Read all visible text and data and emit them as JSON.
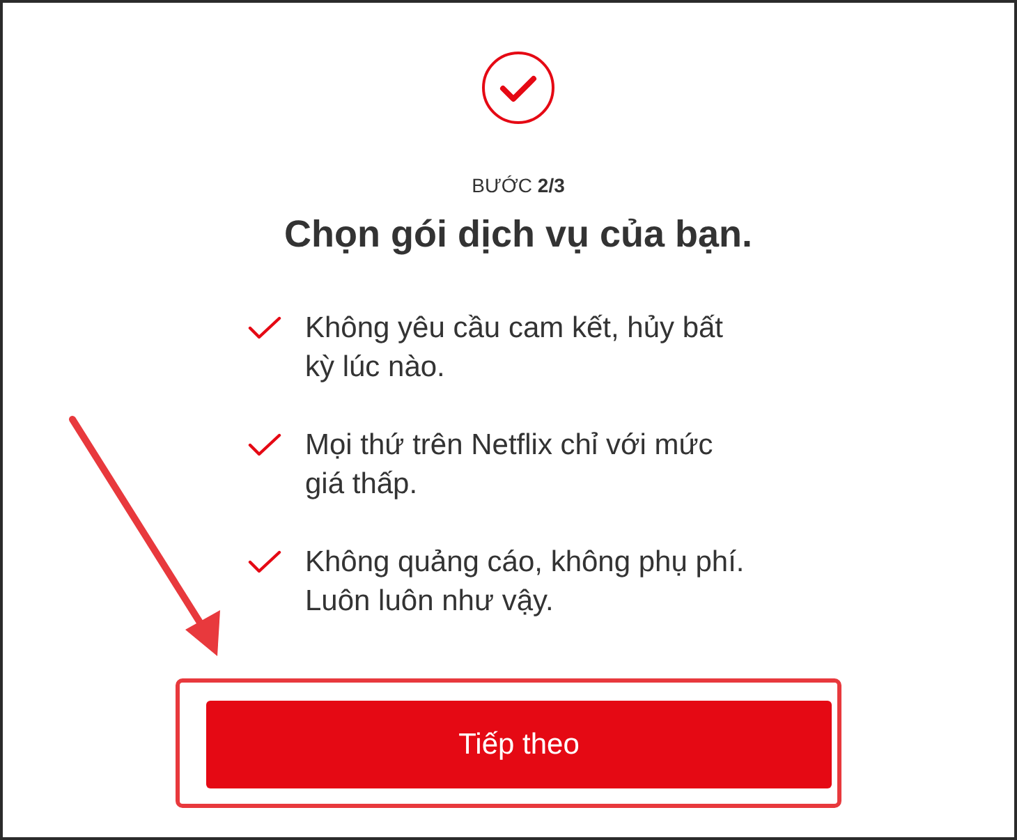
{
  "step": {
    "label": "BƯỚC **2/3**"
  },
  "title": "Chọn gói dịch vụ của bạn.",
  "benefits": [
    {
      "text": "Không yêu cầu cam kết, hủy bất kỳ lúc nào."
    },
    {
      "text": "Mọi thứ trên Netflix chỉ với mức giá thấp."
    },
    {
      "text": "Không quảng cáo, không phụ phí. Luôn luôn như vậy."
    }
  ],
  "next_button": {
    "label": "Tiếp theo"
  }
}
